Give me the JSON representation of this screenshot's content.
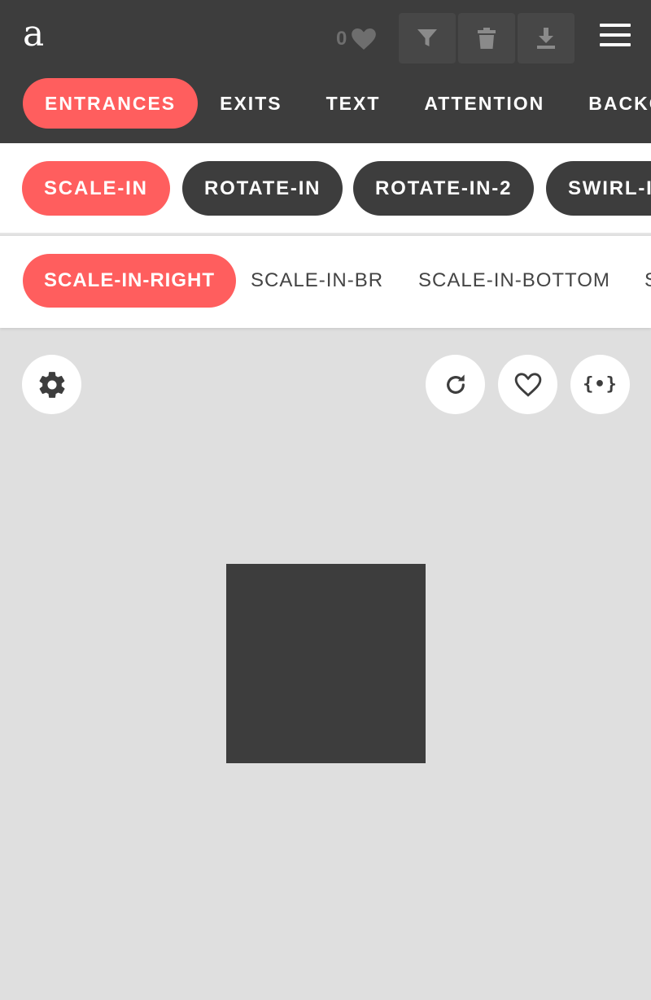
{
  "app": {
    "logo": "a"
  },
  "toolbar": {
    "favorites_count": "0",
    "icons": [
      "heart-icon",
      "filter-icon",
      "trash-icon",
      "download-icon",
      "hamburger-menu-icon"
    ]
  },
  "categories": {
    "items": [
      "ENTRANCES",
      "EXITS",
      "TEXT",
      "ATTENTION",
      "BACKGROUND"
    ],
    "active": "ENTRANCES"
  },
  "groups": {
    "items": [
      "SCALE-IN",
      "ROTATE-IN",
      "ROTATE-IN-2",
      "SWIRL-IN"
    ],
    "active": "SCALE-IN"
  },
  "variants": {
    "items": [
      "SCALE-IN-RIGHT",
      "SCALE-IN-BR",
      "SCALE-IN-BOTTOM",
      "SCALE-IN-BL"
    ],
    "active": "SCALE-IN-RIGHT"
  },
  "stage_controls": {
    "settings_icon": "gear-icon",
    "replay_icon": "replay-icon",
    "favorite_icon": "heart-outline-icon",
    "code_icon": "code-braces-icon",
    "code_glyph": "{•}"
  },
  "colors": {
    "accent": "#ff5e5e",
    "dark": "#3d3d3d",
    "stage_bg": "#dfdfdf",
    "white": "#ffffff"
  }
}
